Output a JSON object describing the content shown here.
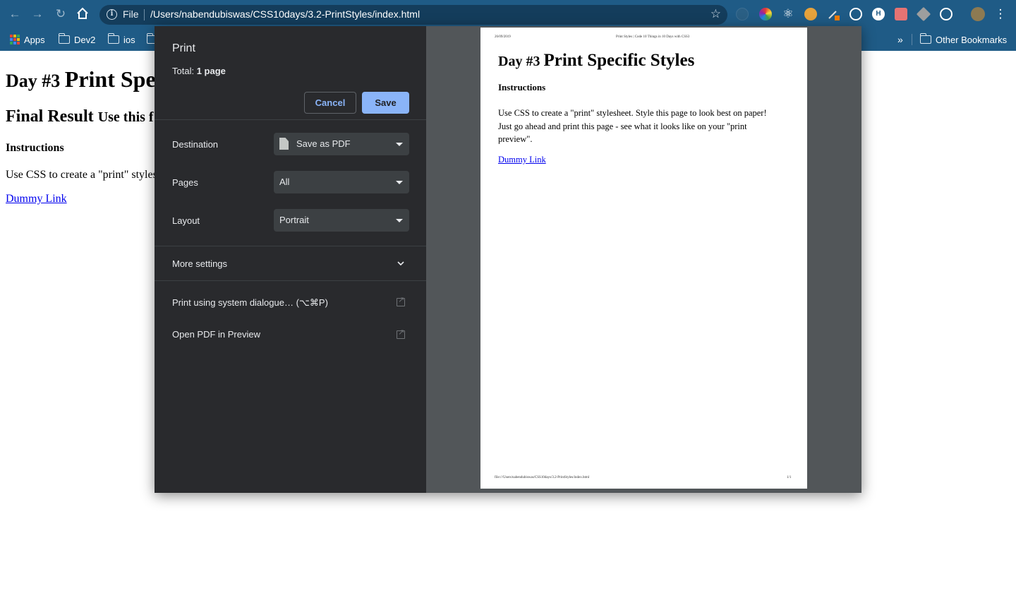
{
  "browser": {
    "address_scheme": "File",
    "address_url": "/Users/nabendubiswas/CSS10days/3.2-PrintStyles/index.html",
    "bookmarks": [
      "Apps",
      "Dev2",
      "ios"
    ],
    "overflow_label": "»",
    "other_bookmarks": "Other Bookmarks"
  },
  "page": {
    "h1_small": "Day #3 ",
    "h1_big": "Print Spe",
    "h2_main": "Final Result ",
    "h2_small": "Use this f",
    "instructions": "Instructions",
    "paragraph": "Use CSS to create a \"print\" styles",
    "link": "Dummy Link"
  },
  "print_dialog": {
    "title": "Print",
    "total_label": "Total: ",
    "total_value": "1 page",
    "cancel": "Cancel",
    "save": "Save",
    "destination_label": "Destination",
    "destination_value": "Save as PDF",
    "pages_label": "Pages",
    "pages_value": "All",
    "layout_label": "Layout",
    "layout_value": "Portrait",
    "more_settings": "More settings",
    "system_dialog": "Print using system dialogue… (⌥⌘P)",
    "open_pdf": "Open PDF in Preview"
  },
  "preview": {
    "header_date": "26/09/2019",
    "header_title": "Print Styles | Code 10 Things in 10 Days with CSS3",
    "h1_small": "Day #3 ",
    "h1_big": "Print Specific Styles",
    "instructions": "Instructions",
    "paragraph": "Use CSS to create a \"print\" stylesheet. Style this page to look best on paper! Just go ahead and print this page - see what it looks like on your \"print preview\".",
    "link": "Dummy Link",
    "footer_path": "file:///Users/nabendubiswas/CSS10days/3.2-PrintStyles/index.html",
    "footer_page": "1/1"
  }
}
